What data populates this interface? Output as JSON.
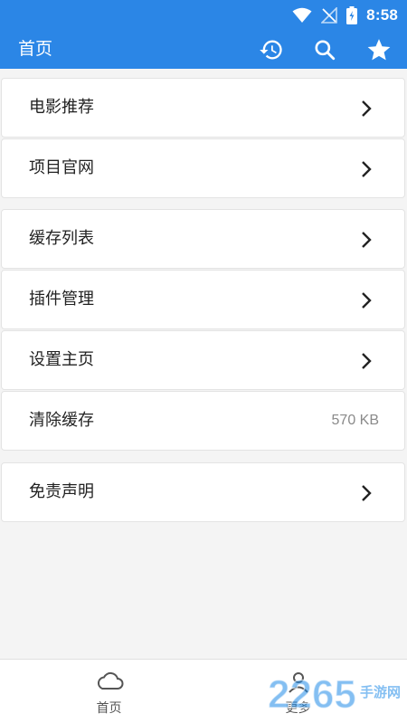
{
  "status_bar": {
    "time": "8:58"
  },
  "app_bar": {
    "title": "首页",
    "actions": [
      {
        "icon": "history-icon"
      },
      {
        "icon": "search-icon"
      },
      {
        "icon": "star-icon"
      }
    ]
  },
  "menu": {
    "group1": [
      {
        "label": "电影推荐"
      },
      {
        "label": "项目官网"
      }
    ],
    "group2": [
      {
        "label": "缓存列表"
      },
      {
        "label": "插件管理"
      },
      {
        "label": "设置主页"
      },
      {
        "label": "清除缓存",
        "value": "570 KB"
      }
    ],
    "group3": [
      {
        "label": "免责声明"
      }
    ]
  },
  "bottom_nav": [
    {
      "label": "首页",
      "icon": "cloud-icon"
    },
    {
      "label": "更多",
      "icon": "user-icon"
    }
  ],
  "watermark": {
    "number": "2265",
    "suffix": "手游网"
  },
  "colors": {
    "primary": "#2b86e6",
    "background": "#f4f4f4",
    "watermark_blue": "#1f8be8"
  }
}
